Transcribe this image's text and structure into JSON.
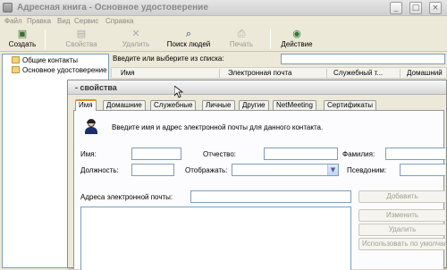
{
  "main_window": {
    "title": "Адресная книга - Основное удостоверение",
    "controls": {
      "minimize": "_",
      "maximize": "□",
      "close": "×"
    }
  },
  "menu": [
    "Файл",
    "Правка",
    "Вид",
    "Сервис",
    "Справка"
  ],
  "toolbar": {
    "buttons": [
      {
        "label": "Создать",
        "icon": "new-contact-icon",
        "glyph": "▣",
        "enabled": true
      },
      {
        "label": "Свойства",
        "icon": "properties-icon",
        "glyph": "▤",
        "enabled": false
      },
      {
        "label": "Удалить",
        "icon": "delete-icon",
        "glyph": "✕",
        "enabled": false
      },
      {
        "label": "Поиск людей",
        "icon": "find-people-icon",
        "glyph": "⌕",
        "enabled": true
      },
      {
        "label": "Печать",
        "icon": "print-icon",
        "glyph": "⎙",
        "enabled": false
      },
      {
        "label": "Действие",
        "icon": "action-icon",
        "glyph": "◉",
        "enabled": true
      }
    ]
  },
  "tree": {
    "items": [
      "Общие контакты",
      "Основное удостоверение"
    ]
  },
  "list": {
    "search_label": "Введите или выберите из списка:",
    "search_value": "",
    "columns": [
      "Имя",
      "Электронная почта",
      "Служебный т...",
      "Домашний"
    ]
  },
  "dialog": {
    "title": "- свойства",
    "tabs": [
      "Имя",
      "Домашние",
      "Служебные",
      "Личные",
      "Другие",
      "NetMeeting",
      "Сертификаты"
    ],
    "active_tab": "Имя",
    "intro": "Введите имя и адрес электронной почты для данного контакта.",
    "fields": {
      "first_name": {
        "label": "Имя:",
        "value": ""
      },
      "middle_name": {
        "label": "Отчество:",
        "value": ""
      },
      "last_name": {
        "label": "Фамилия:",
        "value": ""
      },
      "title": {
        "label": "Должность:",
        "value": ""
      },
      "display": {
        "label": "Отображать:",
        "value": ""
      },
      "nickname": {
        "label": "Псевдоним:",
        "value": ""
      },
      "email": {
        "label": "Адреса электронной почты:",
        "value": ""
      }
    },
    "buttons": [
      "Добавить",
      "Изменить",
      "Удалить",
      "Использовать по умолчанию"
    ]
  }
}
